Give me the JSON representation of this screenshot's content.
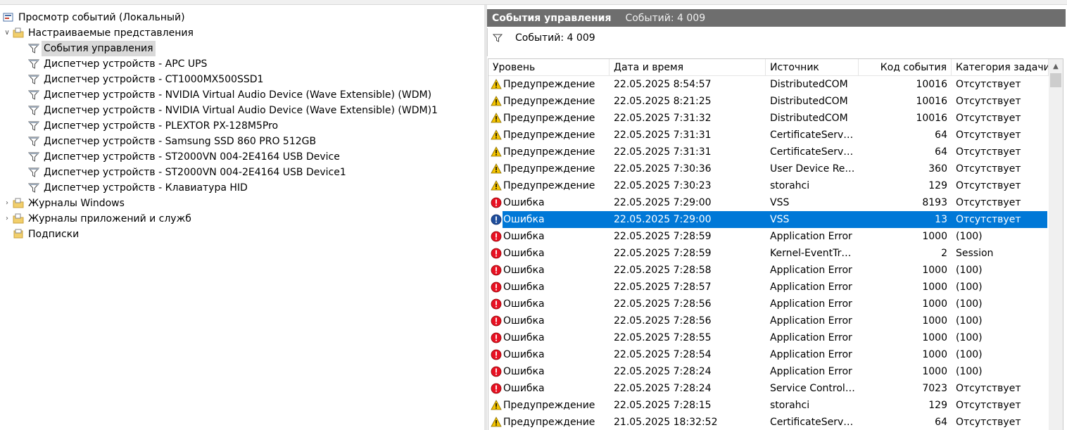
{
  "tree": {
    "root": "Просмотр событий (Локальный)",
    "custom_views": "Настраиваемые представления",
    "children": [
      "События управления",
      "Диспетчер устройств - APC UPS",
      "Диспетчер устройств - CT1000MX500SSD1",
      "Диспетчер устройств - NVIDIA Virtual Audio Device (Wave Extensible) (WDM)",
      "Диспетчер устройств - NVIDIA Virtual Audio Device (Wave Extensible) (WDM)1",
      "Диспетчер устройств - PLEXTOR PX-128M5Pro",
      "Диспетчер устройств - Samsung SSD 860 PRO 512GB",
      "Диспетчер устройств - ST2000VN 004-2E4164 USB Device",
      "Диспетчер устройств - ST2000VN 004-2E4164 USB Device1",
      "Диспетчер устройств - Клавиатура HID"
    ],
    "windows_logs": "Журналы Windows",
    "app_logs": "Журналы приложений и служб",
    "subscriptions": "Подписки"
  },
  "panel": {
    "title": "События управления",
    "count": "Событий: 4 009",
    "filter_text": "Событий: 4 009"
  },
  "columns": {
    "level": "Уровень",
    "datetime": "Дата и время",
    "source": "Источник",
    "event_id": "Код события",
    "category": "Категория задачи"
  },
  "events": [
    {
      "level": "Предупреждение",
      "type": "warning",
      "datetime": "22.05.2025 8:54:57",
      "source": "DistributedCOM",
      "id": "10016",
      "category": "Отсутствует"
    },
    {
      "level": "Предупреждение",
      "type": "warning",
      "datetime": "22.05.2025 8:21:25",
      "source": "DistributedCOM",
      "id": "10016",
      "category": "Отсутствует"
    },
    {
      "level": "Предупреждение",
      "type": "warning",
      "datetime": "22.05.2025 7:31:32",
      "source": "DistributedCOM",
      "id": "10016",
      "category": "Отсутствует"
    },
    {
      "level": "Предупреждение",
      "type": "warning",
      "datetime": "22.05.2025 7:31:31",
      "source": "CertificateServic...",
      "id": "64",
      "category": "Отсутствует"
    },
    {
      "level": "Предупреждение",
      "type": "warning",
      "datetime": "22.05.2025 7:31:31",
      "source": "CertificateServic...",
      "id": "64",
      "category": "Отсутствует"
    },
    {
      "level": "Предупреждение",
      "type": "warning",
      "datetime": "22.05.2025 7:30:36",
      "source": "User Device Reg...",
      "id": "360",
      "category": "Отсутствует"
    },
    {
      "level": "Предупреждение",
      "type": "warning",
      "datetime": "22.05.2025 7:30:23",
      "source": "storahci",
      "id": "129",
      "category": "Отсутствует"
    },
    {
      "level": "Ошибка",
      "type": "error",
      "datetime": "22.05.2025 7:29:00",
      "source": "VSS",
      "id": "8193",
      "category": "Отсутствует"
    },
    {
      "level": "Ошибка",
      "type": "error",
      "datetime": "22.05.2025 7:29:00",
      "source": "VSS",
      "id": "13",
      "category": "Отсутствует",
      "selected": true
    },
    {
      "level": "Ошибка",
      "type": "error",
      "datetime": "22.05.2025 7:28:59",
      "source": "Application Error",
      "id": "1000",
      "category": "(100)"
    },
    {
      "level": "Ошибка",
      "type": "error",
      "datetime": "22.05.2025 7:28:59",
      "source": "Kernel-EventTrac...",
      "id": "2",
      "category": "Session"
    },
    {
      "level": "Ошибка",
      "type": "error",
      "datetime": "22.05.2025 7:28:58",
      "source": "Application Error",
      "id": "1000",
      "category": "(100)"
    },
    {
      "level": "Ошибка",
      "type": "error",
      "datetime": "22.05.2025 7:28:57",
      "source": "Application Error",
      "id": "1000",
      "category": "(100)"
    },
    {
      "level": "Ошибка",
      "type": "error",
      "datetime": "22.05.2025 7:28:56",
      "source": "Application Error",
      "id": "1000",
      "category": "(100)"
    },
    {
      "level": "Ошибка",
      "type": "error",
      "datetime": "22.05.2025 7:28:56",
      "source": "Application Error",
      "id": "1000",
      "category": "(100)"
    },
    {
      "level": "Ошибка",
      "type": "error",
      "datetime": "22.05.2025 7:28:55",
      "source": "Application Error",
      "id": "1000",
      "category": "(100)"
    },
    {
      "level": "Ошибка",
      "type": "error",
      "datetime": "22.05.2025 7:28:54",
      "source": "Application Error",
      "id": "1000",
      "category": "(100)"
    },
    {
      "level": "Ошибка",
      "type": "error",
      "datetime": "22.05.2025 7:28:24",
      "source": "Application Error",
      "id": "1000",
      "category": "(100)"
    },
    {
      "level": "Ошибка",
      "type": "error",
      "datetime": "22.05.2025 7:28:24",
      "source": "Service Control ...",
      "id": "7023",
      "category": "Отсутствует"
    },
    {
      "level": "Предупреждение",
      "type": "warning",
      "datetime": "22.05.2025 7:28:15",
      "source": "storahci",
      "id": "129",
      "category": "Отсутствует"
    },
    {
      "level": "Предупреждение",
      "type": "warning",
      "datetime": "21.05.2025 18:32:52",
      "source": "CertificateServic...",
      "id": "64",
      "category": "Отсутствует"
    }
  ],
  "colors": {
    "selection": "#0078d7",
    "header_bar": "#6e6e6e",
    "warning": "#f5c400",
    "error": "#e81123",
    "info": "#1f4e9c"
  },
  "icons": {
    "filter": "filter-icon",
    "warning": "warning-icon",
    "error": "error-icon",
    "folder": "folder-icon",
    "computer": "event-viewer-icon"
  }
}
